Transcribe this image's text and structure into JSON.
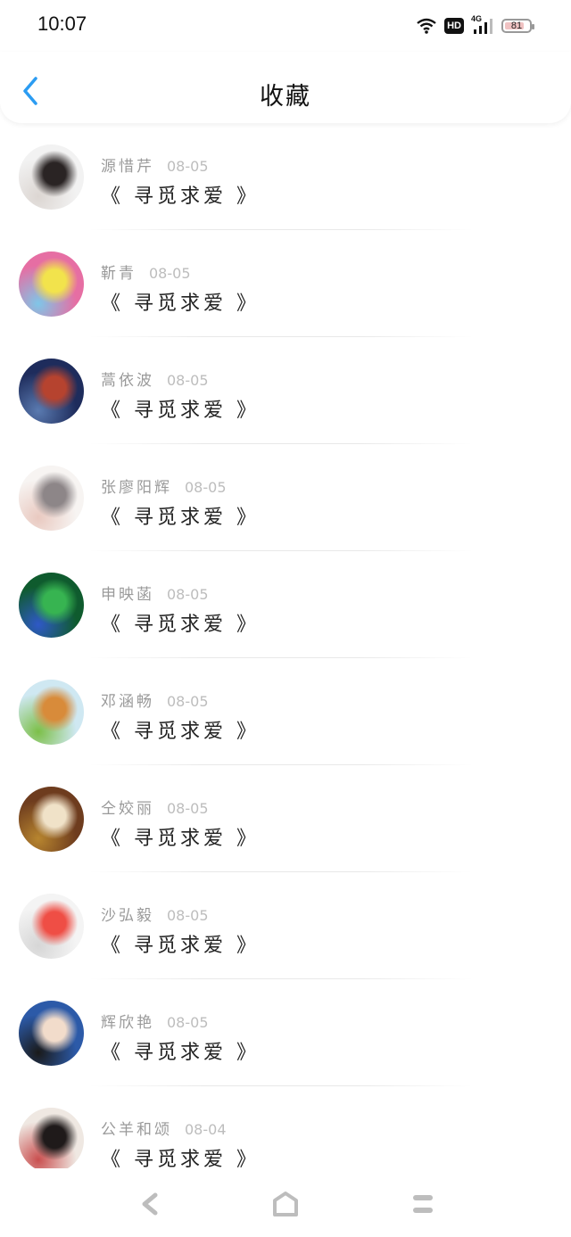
{
  "status": {
    "time": "10:07",
    "hd": "HD",
    "network": "4G",
    "battery": 81
  },
  "header": {
    "title": "收藏",
    "back_icon": "chevron-left-icon",
    "accent_color": "#2b9cf2"
  },
  "items": [
    {
      "name": "源惜芹",
      "date": "08-05",
      "title": "《 寻觅求爱 》",
      "avatar_colors": [
        "#f2f2f2",
        "#2a2424",
        "#dcd6d2"
      ]
    },
    {
      "name": "靳青",
      "date": "08-05",
      "title": "《 寻觅求爱 》",
      "avatar_colors": [
        "#e66ea3",
        "#f2e34c",
        "#7fc6e8"
      ]
    },
    {
      "name": "蒿依波",
      "date": "08-05",
      "title": "《 寻觅求爱 》",
      "avatar_colors": [
        "#1e2c5c",
        "#b6432f",
        "#5a7ab0"
      ]
    },
    {
      "name": "张廖阳辉",
      "date": "08-05",
      "title": "《 寻觅求爱 》",
      "avatar_colors": [
        "#f7f4f2",
        "#8d8688",
        "#e9c9c0"
      ]
    },
    {
      "name": "申映菡",
      "date": "08-05",
      "title": "《 寻觅求爱 》",
      "avatar_colors": [
        "#0f5b2e",
        "#37b451",
        "#2f59c7"
      ]
    },
    {
      "name": "邓涵畅",
      "date": "08-05",
      "title": "《 寻觅求爱 》",
      "avatar_colors": [
        "#cfe8f2",
        "#d88b3a",
        "#7cbf48"
      ]
    },
    {
      "name": "仝姣丽",
      "date": "08-05",
      "title": "《 寻觅求爱 》",
      "avatar_colors": [
        "#6e3c1e",
        "#f0e2c8",
        "#b7852f"
      ]
    },
    {
      "name": "沙弘毅",
      "date": "08-05",
      "title": "《 寻觅求爱 》",
      "avatar_colors": [
        "#f4f4f4",
        "#ef4e45",
        "#d6d6d6"
      ]
    },
    {
      "name": "辉欣艳",
      "date": "08-05",
      "title": "《 寻觅求爱 》",
      "avatar_colors": [
        "#2c5aa8",
        "#f2dccb",
        "#1a1a1a"
      ]
    },
    {
      "name": "公羊和颂",
      "date": "08-04",
      "title": "《 寻觅求爱 》",
      "avatar_colors": [
        "#efe8e2",
        "#1f1a1a",
        "#c94f4f"
      ]
    }
  ],
  "nav": {
    "back_icon": "triangle-back-icon",
    "home_icon": "home-icon",
    "menu_icon": "menu-lines-icon"
  }
}
